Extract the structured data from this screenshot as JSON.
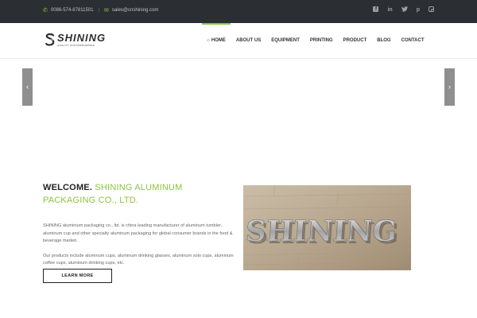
{
  "topbar": {
    "phone": "0086-574-87811501",
    "separator": "|",
    "email": "sales@cnshining.com",
    "social": [
      "facebook-icon",
      "linkedin-icon",
      "twitter-icon",
      "pinterest-icon",
      "instagram-icon"
    ]
  },
  "logo": {
    "brand": "SHINING",
    "tagline": "QUALITY UNCOMPROMISED"
  },
  "nav": {
    "items": [
      {
        "label": "HOME"
      },
      {
        "label": "ABOUT US"
      },
      {
        "label": "EQUIPMENT"
      },
      {
        "label": "PRINTING"
      },
      {
        "label": "PRODUCT"
      },
      {
        "label": "BLOG"
      },
      {
        "label": "CONTACT"
      }
    ],
    "active": "HOME"
  },
  "slider": {
    "prev_glyph": "‹",
    "next_glyph": "›"
  },
  "welcome": {
    "title_strong": "WELCOME.",
    "title_green": "SHINING ALUMINUM PACKAGING CO., LTD.",
    "paragraph1": "SHINING aluminium packaging co., ltd. is china leading manufacturer of aluminum tumbler, aluminum cup and other specialty aluminum packaging for global consumer brands in the food & beverage market.",
    "paragraph2": "Our products include aluminum cups, aluminum drinking glasses, aluminum solo cups, aluminum coffee cups,  aluminum drinking cups, etc.",
    "button": "LEARN MORE"
  },
  "photo": {
    "sign_text": "SHINING"
  },
  "colors": {
    "accent": "#8cc540",
    "topbar": "#2b2f33",
    "arrow": "#8f8f8f"
  }
}
